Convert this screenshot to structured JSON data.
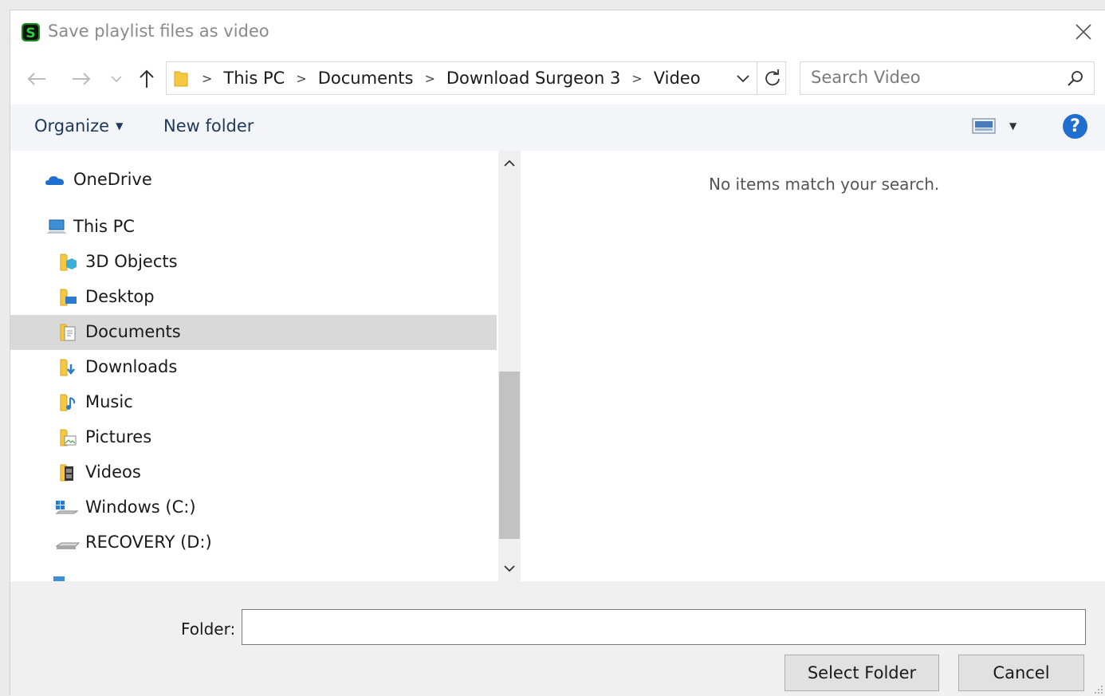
{
  "window": {
    "title": "Save playlist files as video",
    "app_icon_letter": "S",
    "app_icon_color": "#1a8a1a"
  },
  "address": {
    "crumbs": [
      "This PC",
      "Documents",
      "Download Surgeon 3",
      "Video"
    ]
  },
  "search": {
    "placeholder": "Search Video"
  },
  "toolbar": {
    "organize_label": "Organize",
    "new_folder_label": "New folder",
    "help_label": "?"
  },
  "nav": {
    "items": [
      {
        "label": "OneDrive",
        "icon": "onedrive-icon"
      },
      {
        "label": "This PC",
        "icon": "this-pc-icon"
      },
      {
        "label": "3D Objects",
        "icon": "3d-objects-folder-icon"
      },
      {
        "label": "Desktop",
        "icon": "desktop-folder-icon"
      },
      {
        "label": "Documents",
        "icon": "documents-folder-icon",
        "selected": true
      },
      {
        "label": "Downloads",
        "icon": "downloads-folder-icon"
      },
      {
        "label": "Music",
        "icon": "music-folder-icon"
      },
      {
        "label": "Pictures",
        "icon": "pictures-folder-icon"
      },
      {
        "label": "Videos",
        "icon": "videos-folder-icon"
      },
      {
        "label": "Windows (C:)",
        "icon": "windows-drive-icon"
      },
      {
        "label": "RECOVERY (D:)",
        "icon": "drive-icon"
      }
    ]
  },
  "content": {
    "empty_message": "No items match your search."
  },
  "footer": {
    "folder_label": "Folder:",
    "folder_value": "",
    "select_button": "Select Folder",
    "cancel_button": "Cancel"
  },
  "colors": {
    "accent": "#1f6fd1",
    "command_text": "#1e395b",
    "selection": "#d9d9d9",
    "folder_yellow": "#f5c842"
  }
}
